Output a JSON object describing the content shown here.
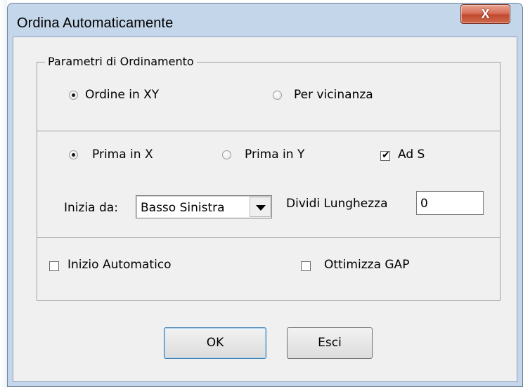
{
  "window": {
    "title": "Ordina Automaticamente",
    "close_glyph": "X"
  },
  "group": {
    "legend": "Parametri di Ordinamento"
  },
  "sort_mode": {
    "option_xy": "Ordine in XY",
    "option_near": "Per vicinanza",
    "selected": "xy"
  },
  "priority": {
    "option_x": "Prima in X",
    "option_y": "Prima in Y",
    "selected": "x",
    "ads_label": "Ad S",
    "ads_checked": true
  },
  "start": {
    "label": "Inizia da:",
    "value": "Basso Sinistra"
  },
  "split": {
    "label": "Dividi Lunghezza",
    "value": "0"
  },
  "options": {
    "auto_start_label": "Inizio Automatico",
    "auto_start_checked": false,
    "gap_label": "Ottimizza GAP",
    "gap_checked": false
  },
  "buttons": {
    "ok": "OK",
    "exit": "Esci"
  },
  "colors": {
    "frame": "#c4d6ea",
    "client": "#f0f0f0",
    "close_button": "#c14a30"
  }
}
